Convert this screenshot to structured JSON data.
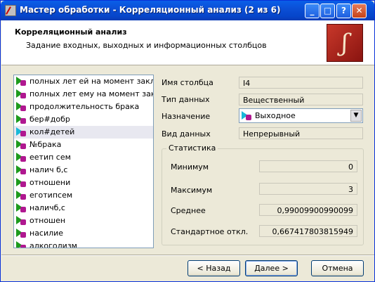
{
  "window": {
    "title": "Мастер обработки - Корреляционный анализ (2 из 6)"
  },
  "header": {
    "title": "Корреляционный анализ",
    "subtitle": "Задание входных, выходных и информационных столбцов"
  },
  "columns": [
    {
      "label": "полных лет ей на момент заклю...",
      "icon": "input-column-icon"
    },
    {
      "label": "полных лет ему на момент закл...",
      "icon": "input-column-icon"
    },
    {
      "label": "продолжительность брака",
      "icon": "input-column-icon"
    },
    {
      "label": "бер#добр",
      "icon": "input-column-icon"
    },
    {
      "label": "кол#детей",
      "icon": "output-column-icon",
      "selected": true
    },
    {
      "label": "№брака",
      "icon": "input-column-icon"
    },
    {
      "label": "еетип сем",
      "icon": "input-column-icon"
    },
    {
      "label": "налич б,с",
      "icon": "input-column-icon"
    },
    {
      "label": "отношени",
      "icon": "input-column-icon"
    },
    {
      "label": "еготипсем",
      "icon": "input-column-icon"
    },
    {
      "label": "наличб,с",
      "icon": "input-column-icon"
    },
    {
      "label": "отношен",
      "icon": "input-column-icon"
    },
    {
      "label": "насилие",
      "icon": "input-column-icon"
    },
    {
      "label": "алкоголизм",
      "icon": "input-column-icon"
    }
  ],
  "properties": {
    "name_label": "Имя столбца",
    "name_value": "I4",
    "type_label": "Тип данных",
    "type_value": "Вещественный",
    "purpose_label": "Назначение",
    "purpose_value": "Выходное",
    "kind_label": "Вид данных",
    "kind_value": "Непрерывный"
  },
  "stats": {
    "title": "Статистика",
    "min_label": "Минимум",
    "min_value": "0",
    "max_label": "Максимум",
    "max_value": "3",
    "mean_label": "Среднее",
    "mean_value": "0,99009900990099",
    "std_label": "Стандартное откл.",
    "std_value": "0,667417803815949"
  },
  "buttons": {
    "back": "< Назад",
    "next": "Далее >",
    "cancel": "Отмена"
  }
}
